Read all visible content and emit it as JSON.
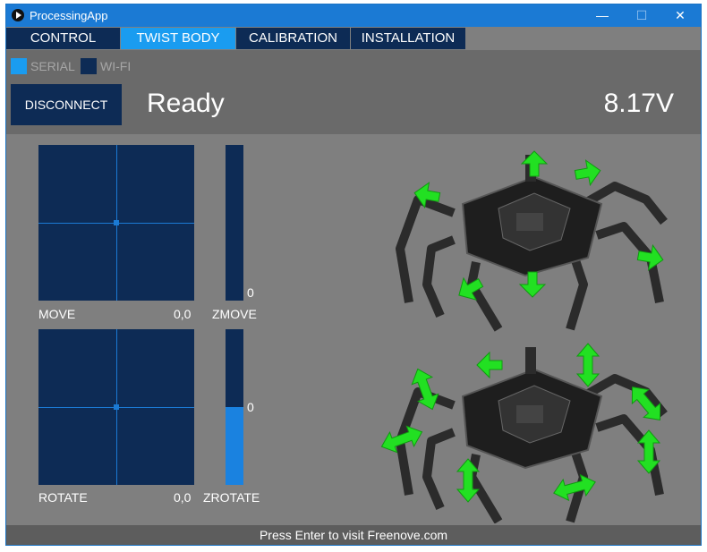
{
  "window": {
    "title": "ProcessingApp",
    "minimize_glyph": "—",
    "maximize_glyph": "☐",
    "close_glyph": "✕"
  },
  "tabs": [
    {
      "label": "CONTROL",
      "active": false
    },
    {
      "label": "TWIST BODY",
      "active": true
    },
    {
      "label": "CALIBRATION",
      "active": false
    },
    {
      "label": "INSTALLATION",
      "active": false
    }
  ],
  "connection": {
    "serial_label": "SERIAL",
    "wifi_label": "WI-FI",
    "serial_selected": true,
    "wifi_selected": false,
    "disconnect_label": "DISCONNECT",
    "status": "Ready",
    "voltage": "8.17V"
  },
  "controls": {
    "move": {
      "label": "MOVE",
      "value": "0,0"
    },
    "zmove": {
      "label": "ZMOVE",
      "value": "0",
      "level": 0
    },
    "rotate": {
      "label": "ROTATE",
      "value": "0,0"
    },
    "zrotate": {
      "label": "ZROTATE",
      "value": "0",
      "level": 0.5
    }
  },
  "illustrations": [
    {
      "name": "hexapod-translate-illustration"
    },
    {
      "name": "hexapod-rotate-illustration"
    }
  ],
  "colors": {
    "dark_blue": "#0d2b55",
    "active_blue": "#1a9cf0",
    "arrow_green": "#22e022",
    "background_gray": "#7f7f7f"
  },
  "footer": {
    "text": "Press Enter to visit Freenove.com"
  }
}
